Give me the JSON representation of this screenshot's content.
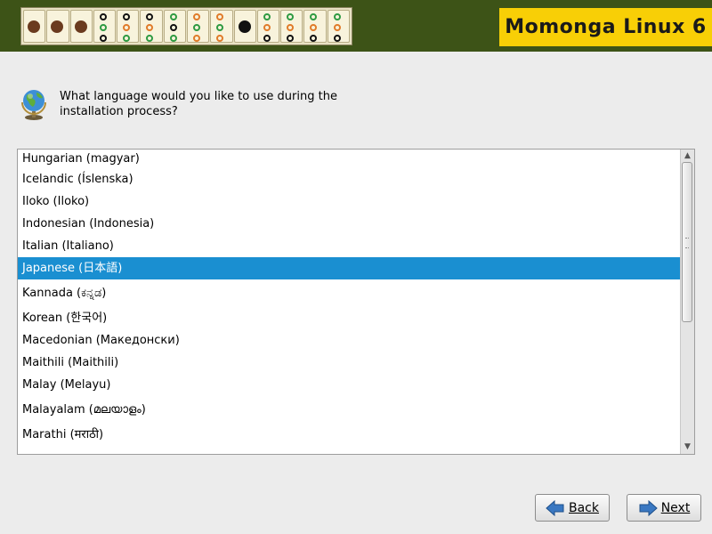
{
  "header": {
    "brand": "Momonga Linux 6",
    "colors": {
      "banner_bg": "#3d5317",
      "brand_bg": "#f8cf06",
      "tiles_bg": "#e9e2c4"
    }
  },
  "question": {
    "icon": "globe-icon",
    "text": "What language would you like to use during the installation process?"
  },
  "language_list": {
    "selected": "Japanese (日本語)",
    "items": [
      "Hungarian (magyar)",
      "Icelandic (Íslenska)",
      "Iloko (Iloko)",
      "Indonesian (Indonesia)",
      "Italian (Italiano)",
      "Japanese (日本語)",
      "Kannada (ಕನ್ನಡ)",
      "Korean (한국어)",
      "Macedonian (Македонски)",
      "Maithili (Maithili)",
      "Malay (Melayu)",
      "Malayalam (മലയാളം)",
      "Marathi (मराठी)"
    ],
    "selection_color": "#1a8fd1"
  },
  "buttons": {
    "back_label": "Back",
    "next_label": "Next",
    "back_icon": "arrow-left-icon",
    "next_icon": "arrow-right-icon"
  }
}
